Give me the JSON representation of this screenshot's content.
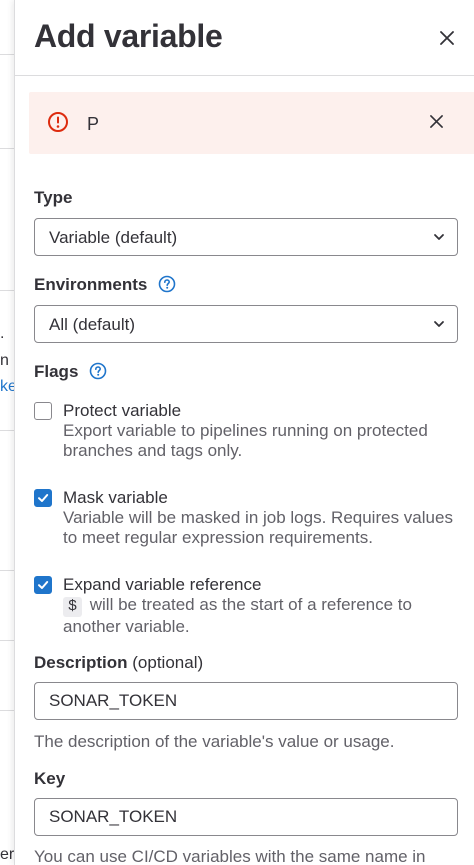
{
  "background": {
    "fragments": [
      ".",
      "n",
      "ke",
      "er"
    ]
  },
  "drawer": {
    "title": "Add variable",
    "close_icon": "close-icon"
  },
  "alert": {
    "message": "P",
    "icon": "error-circle-icon",
    "dismiss_icon": "close-icon"
  },
  "form": {
    "type": {
      "label": "Type",
      "value": "Variable (default)"
    },
    "environments": {
      "label": "Environments",
      "value": "All (default)"
    },
    "flags": {
      "label": "Flags",
      "protect": {
        "label": "Protect variable",
        "help": "Export variable to pipelines running on protected branches and tags only.",
        "checked": false
      },
      "mask": {
        "label": "Mask variable",
        "help": "Variable will be masked in job logs. Requires values to meet regular expression requirements.",
        "checked": true
      },
      "expand": {
        "label": "Expand variable reference",
        "code": "$",
        "help": "will be treated as the start of a reference to another variable.",
        "checked": true
      }
    },
    "description": {
      "label": "Description",
      "optional": "(optional)",
      "value": "SONAR_TOKEN",
      "help": "The description of the variable's value or usage."
    },
    "key": {
      "label": "Key",
      "value": "SONAR_TOKEN",
      "help": "You can use CI/CD variables with the same name in"
    }
  },
  "colors": {
    "accent": "#1f75cb",
    "alert_bg": "#fdf0ed",
    "danger": "#dd2b0e"
  }
}
